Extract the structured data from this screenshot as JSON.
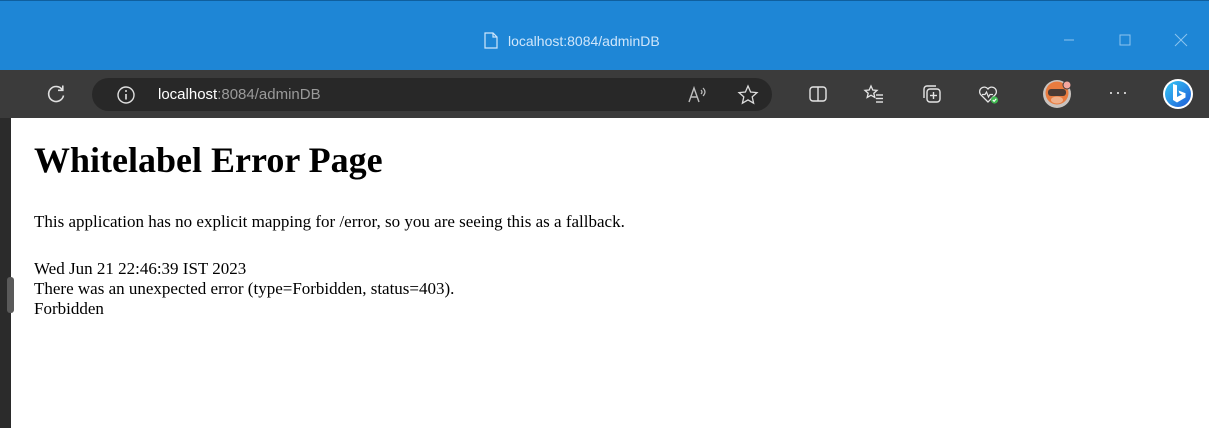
{
  "window": {
    "title": "localhost:8084/adminDB"
  },
  "toolbar": {
    "url_host": "localhost",
    "url_rest": ":8084/adminDB",
    "more_label": "···"
  },
  "icons": {
    "refresh": "refresh-icon",
    "info": "info-icon",
    "read_aloud": "read-aloud-icon",
    "favorite": "star-icon",
    "split_screen": "split-screen-icon",
    "favorites": "favorites-icon",
    "collections": "collections-icon",
    "browser_essentials": "heartbeat-icon",
    "profile": "profile-avatar",
    "copilot": "bing-icon"
  },
  "colors": {
    "titlebar": "#1e86d6",
    "toolbar": "#3b3b3b",
    "address_bar": "#282828",
    "accent": "#1e86d6"
  },
  "page": {
    "heading": "Whitelabel Error Page",
    "message": "This application has no explicit mapping for /error, so you are seeing this as a fallback.",
    "timestamp": "Wed Jun 21 22:46:39 IST 2023",
    "error_line": "There was an unexpected error (type=Forbidden, status=403).",
    "error_detail": "Forbidden"
  }
}
